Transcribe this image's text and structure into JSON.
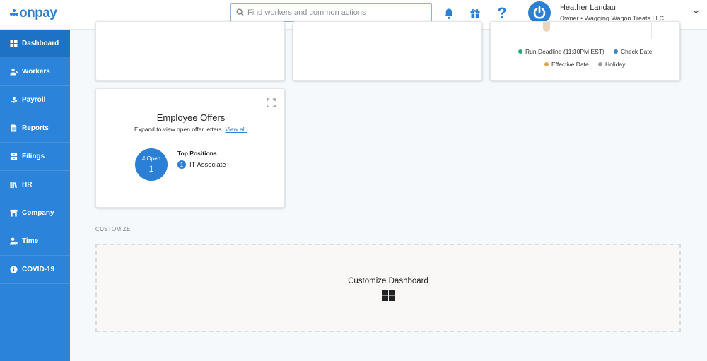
{
  "header": {
    "logo_text": "onpay",
    "search_placeholder": "Find workers and common actions",
    "user_name": "Heather Landau",
    "user_role": "Owner • Wagging Wagon Treats LLC",
    "help_glyph": "?",
    "accent_color": "#2b7fd4"
  },
  "sidebar": {
    "background": "#2b84da",
    "items": [
      {
        "label": "Dashboard",
        "icon": "dashboard-icon",
        "active": true
      },
      {
        "label": "Workers",
        "icon": "workers-icon"
      },
      {
        "label": "Payroll",
        "icon": "payroll-icon"
      },
      {
        "label": "Reports",
        "icon": "reports-icon"
      },
      {
        "label": "Filings",
        "icon": "filings-icon"
      },
      {
        "label": "HR",
        "icon": "hr-icon"
      },
      {
        "label": "Company",
        "icon": "company-icon"
      },
      {
        "label": "Time",
        "icon": "time-icon"
      },
      {
        "label": "COVID-19",
        "icon": "info-icon"
      }
    ]
  },
  "calendar_legend": {
    "items": [
      {
        "label": "Run Deadline (11:30PM EST)",
        "color": "#2aa876"
      },
      {
        "label": "Check Date",
        "color": "#3d86c6"
      },
      {
        "label": "Effective Date",
        "color": "#e0a44a"
      },
      {
        "label": "Holiday",
        "color": "#9e9e9e"
      }
    ]
  },
  "offers": {
    "title": "Employee Offers",
    "subtitle": "Expand to view open offer letters.",
    "view_all": "View all.",
    "open_label": "# Open",
    "open_count": "1",
    "top_positions_title": "Top Positions",
    "positions": [
      {
        "rank": "1",
        "name": "IT Associate"
      }
    ]
  },
  "customize": {
    "section_label": "CUSTOMIZE",
    "button_label": "Customize Dashboard"
  }
}
